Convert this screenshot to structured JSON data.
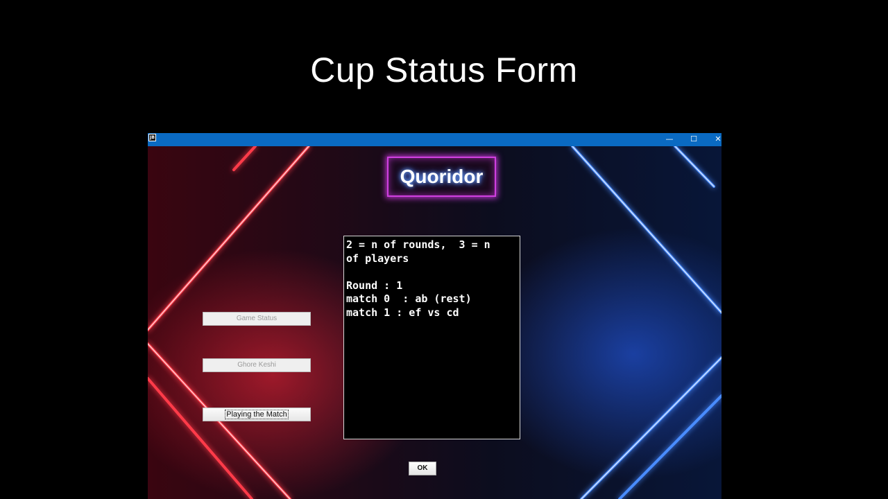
{
  "slide": {
    "title": "Cup Status Form"
  },
  "window": {
    "app_icon_label": "JB",
    "controls": {
      "minimize": "—",
      "maximize": "☐",
      "close": "✕"
    }
  },
  "logo": {
    "text": "Quoridor"
  },
  "buttons": {
    "game_status": "Game Status",
    "ghore_keshi": "Ghore Keshi",
    "playing_match": "Playing the Match",
    "ok": "OK"
  },
  "status_text": "2 = n of rounds,  3 = n\nof players\n\nRound : 1\nmatch 0  : ab (rest)\nmatch 1 : ef vs cd",
  "colors": {
    "titlebar": "#0a6ac2",
    "neon_red": "#ff3040",
    "neon_blue": "#4a8cff",
    "logo_border": "#d040e0"
  }
}
